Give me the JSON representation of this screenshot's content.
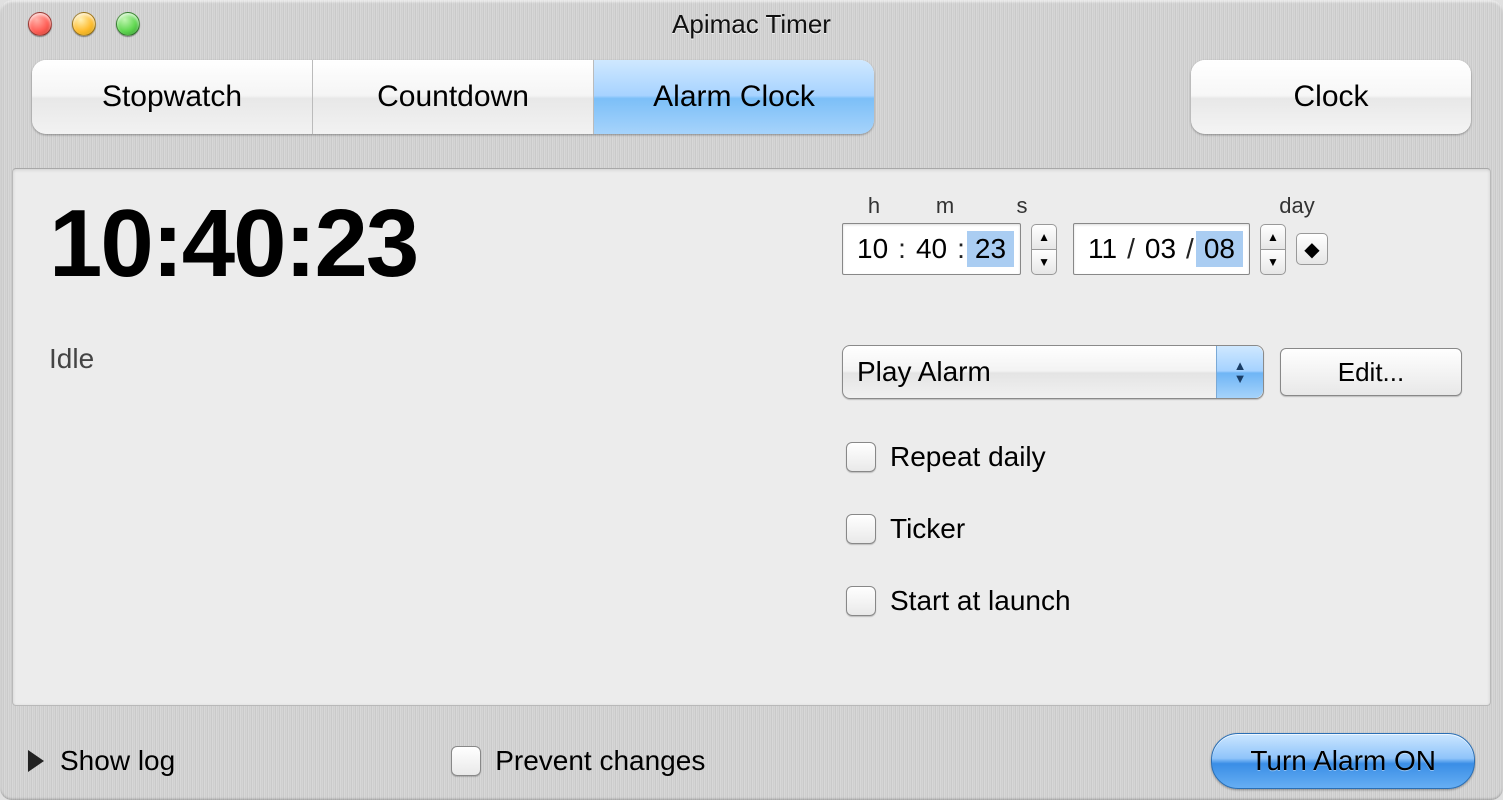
{
  "window": {
    "title": "Apimac Timer"
  },
  "tabs": {
    "items": [
      "Stopwatch",
      "Countdown",
      "Alarm Clock"
    ],
    "active_index": 2,
    "clock_label": "Clock"
  },
  "display": {
    "time": "10:40:23",
    "status": "Idle"
  },
  "time_picker": {
    "labels": {
      "h": "h",
      "m": "m",
      "s": "s",
      "day": "day"
    },
    "h": "10",
    "m": "40",
    "s": "23",
    "selected_time_part": "s",
    "date_dd": "11",
    "date_mm": "03",
    "date_yy": "08",
    "selected_date_part": "yy"
  },
  "action": {
    "selected": "Play Alarm",
    "edit_label": "Edit..."
  },
  "options": {
    "repeat_daily": {
      "label": "Repeat daily",
      "checked": false
    },
    "ticker": {
      "label": "Ticker",
      "checked": false
    },
    "start_at_launch": {
      "label": "Start at launch",
      "checked": false
    }
  },
  "footer": {
    "show_log": "Show log",
    "prevent_changes": {
      "label": "Prevent changes",
      "checked": false
    },
    "primary_button": "Turn Alarm ON"
  }
}
